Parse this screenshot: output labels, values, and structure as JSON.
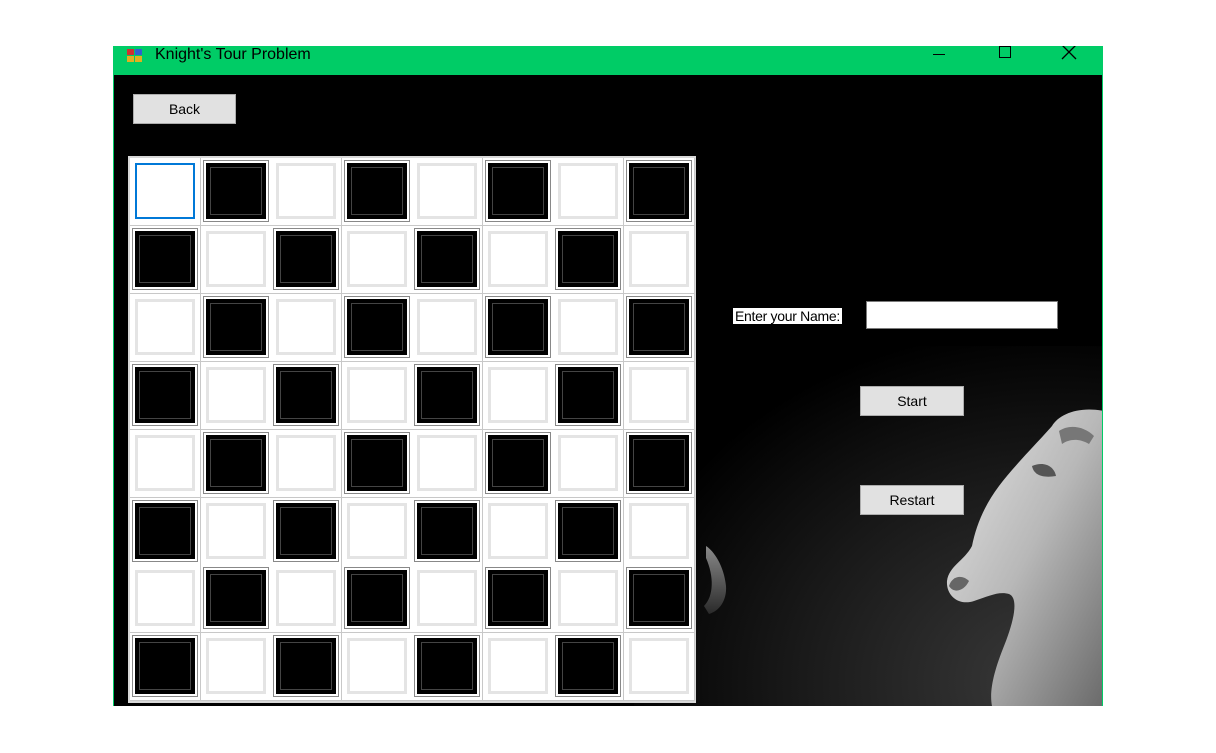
{
  "window": {
    "title": "Knight's Tour Problem",
    "titlebar_color": "#00cc66",
    "icon": "app-form-icon"
  },
  "controls": {
    "back_label": "Back",
    "name_label": "Enter your Name:",
    "name_value": "",
    "start_label": "Start",
    "restart_label": "Restart"
  },
  "board": {
    "rows": 8,
    "cols": 8,
    "pattern": [
      [
        "focused",
        "dark",
        "light",
        "dark",
        "light",
        "dark",
        "light",
        "dark"
      ],
      [
        "dark",
        "light",
        "dark",
        "light",
        "dark",
        "light",
        "dark",
        "light"
      ],
      [
        "light",
        "dark",
        "light",
        "dark",
        "light",
        "dark",
        "light",
        "dark"
      ],
      [
        "dark",
        "light",
        "dark",
        "light",
        "dark",
        "light",
        "dark",
        "light"
      ],
      [
        "light",
        "dark",
        "light",
        "dark",
        "light",
        "dark",
        "light",
        "dark"
      ],
      [
        "dark",
        "light",
        "dark",
        "light",
        "dark",
        "light",
        "dark",
        "light"
      ],
      [
        "light",
        "dark",
        "light",
        "dark",
        "light",
        "dark",
        "light",
        "dark"
      ],
      [
        "dark",
        "light",
        "dark",
        "light",
        "dark",
        "light",
        "dark",
        "light"
      ]
    ]
  },
  "colors": {
    "background": "#000000",
    "focus": "#0078d7"
  }
}
